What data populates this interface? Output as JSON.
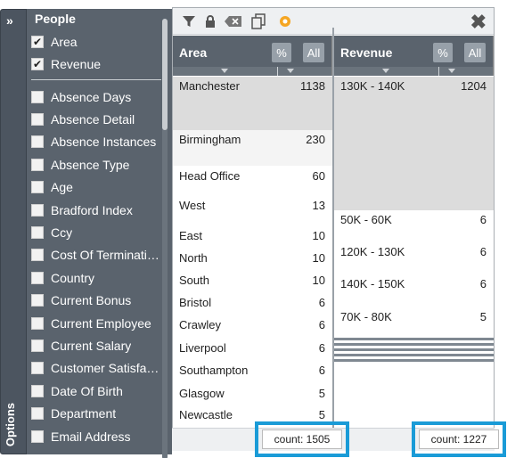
{
  "options": {
    "label": "Options",
    "expand_glyph": "»"
  },
  "fields": {
    "section_title": "People",
    "selected": [
      {
        "label": "Area",
        "checked": true
      },
      {
        "label": "Revenue",
        "checked": true
      }
    ],
    "available": [
      {
        "label": "Absence Days"
      },
      {
        "label": "Absence Detail"
      },
      {
        "label": "Absence Instances"
      },
      {
        "label": "Absence Type"
      },
      {
        "label": "Age"
      },
      {
        "label": "Bradford Index"
      },
      {
        "label": "Ccy"
      },
      {
        "label": "Cost Of Terminati…"
      },
      {
        "label": "Country"
      },
      {
        "label": "Current Bonus"
      },
      {
        "label": "Current Employee"
      },
      {
        "label": "Current Salary"
      },
      {
        "label": "Customer Satisfa…"
      },
      {
        "label": "Date Of Birth"
      },
      {
        "label": "Department"
      },
      {
        "label": "Email Address"
      }
    ]
  },
  "toolbar": {
    "icons": [
      "filter-icon",
      "lock-icon",
      "clear-icon",
      "copy-icon",
      "settings-icon",
      "close-icon"
    ],
    "close_glyph": "✖"
  },
  "columns": [
    {
      "title": "Area",
      "pct_label": "%",
      "all_label": "All",
      "rows": [
        {
          "name": "Manchester",
          "value": "1138"
        },
        {
          "name": "Birmingham",
          "value": "230"
        },
        {
          "name": "Head Office",
          "value": "60"
        },
        {
          "name": "West",
          "value": "13"
        },
        {
          "name": "East",
          "value": "10"
        },
        {
          "name": "North",
          "value": "10"
        },
        {
          "name": "South",
          "value": "10"
        },
        {
          "name": "Bristol",
          "value": "6"
        },
        {
          "name": "Crawley",
          "value": "6"
        },
        {
          "name": "Liverpool",
          "value": "6"
        },
        {
          "name": "Southampton",
          "value": "6"
        },
        {
          "name": "Glasgow",
          "value": "5"
        },
        {
          "name": "Newcastle",
          "value": "5"
        }
      ],
      "count": "count: 1505"
    },
    {
      "title": "Revenue",
      "pct_label": "%",
      "all_label": "All",
      "rows": [
        {
          "name": "130K - 140K",
          "value": "1204"
        },
        {
          "name": "50K - 60K",
          "value": "6"
        },
        {
          "name": "120K - 130K",
          "value": "6"
        },
        {
          "name": "140K - 150K",
          "value": "6"
        },
        {
          "name": "70K - 80K",
          "value": "5"
        }
      ],
      "count": "count: 1227"
    }
  ],
  "colors": {
    "panel": "#5a636d",
    "highlight": "#1a9bd7",
    "selected_row": "#dcdcdc"
  }
}
